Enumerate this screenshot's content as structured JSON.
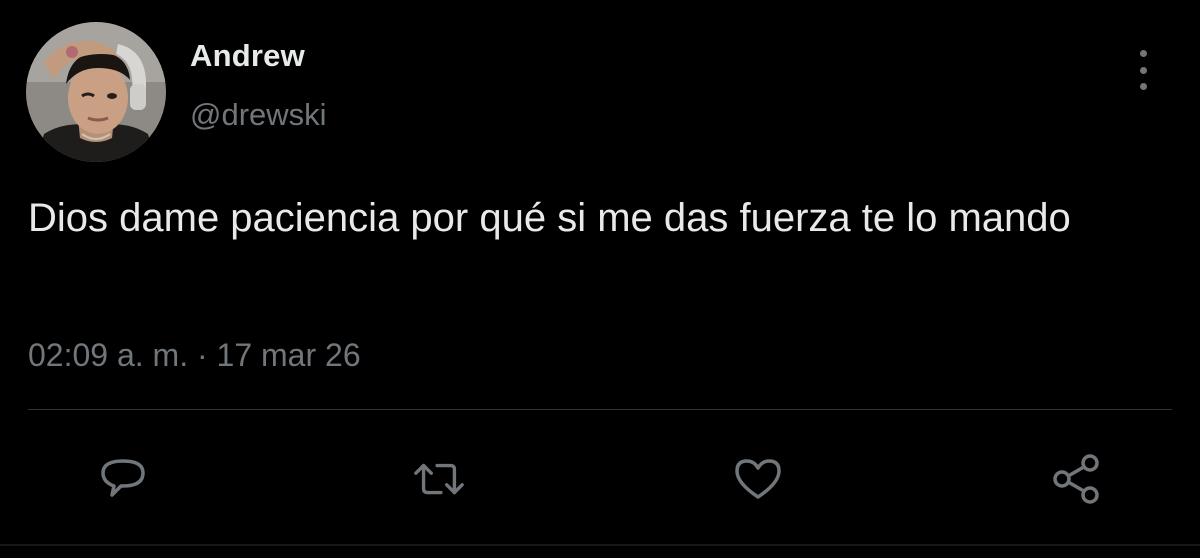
{
  "author": {
    "display_name": "Andrew",
    "handle": "@drewski",
    "avatar_icon": "profile-photo"
  },
  "tweet": {
    "text": "Dios dame paciencia por qué si me das fuerza te lo mando",
    "timestamp": "02:09 a. m. · 17 mar 26"
  },
  "actions": {
    "reply_icon": "comment-bubble-icon",
    "retweet_icon": "retweet-arrows-icon",
    "like_icon": "heart-icon",
    "share_icon": "share-nodes-icon",
    "more_icon": "vertical-dots-icon"
  },
  "colors": {
    "background": "#000000",
    "text_primary": "#e7e9ea",
    "text_secondary": "#71767b",
    "divider": "#2f3336"
  }
}
